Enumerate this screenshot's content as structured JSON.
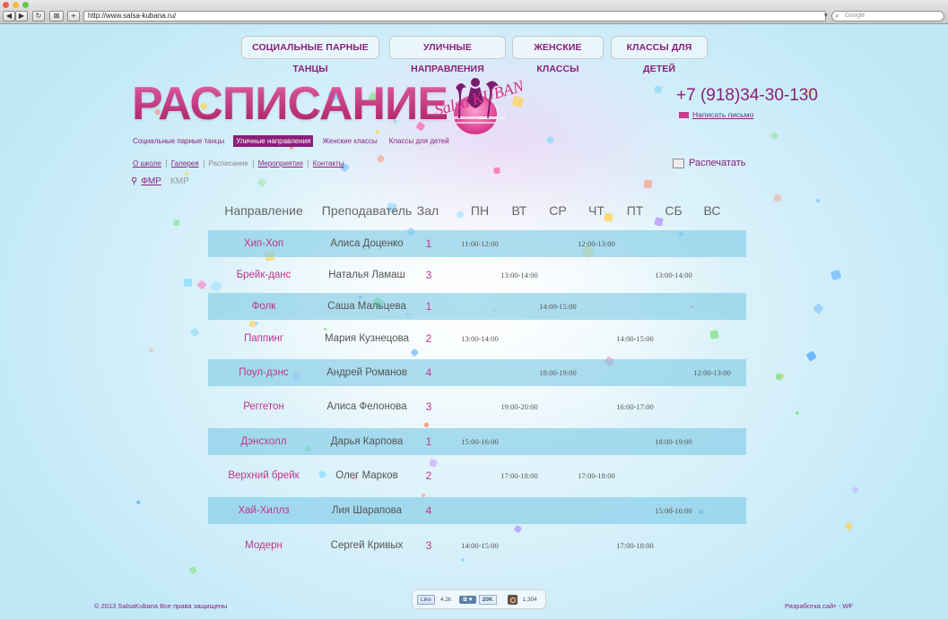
{
  "browser": {
    "url": "http://www.salsa-kubana.ru/",
    "search_placeholder": "Google",
    "back": "◀",
    "forward": "▶",
    "reload": "↻",
    "tabs": "⊠",
    "add": "+"
  },
  "top_nav": [
    "СОЦИАЛЬНЫЕ ПАРНЫЕ ТАНЦЫ",
    "УЛИЧНЫЕ НАПРАВЛЕНИЯ",
    "ЖЕНСКИЕ КЛАССЫ",
    "КЛАССЫ ДЛЯ ДЕТЕЙ"
  ],
  "page_title": "РАСПИСАНИЕ",
  "logo": {
    "text_main": "Salsa KUBANA",
    "text_sub": "dance school"
  },
  "contact": {
    "phone": "+7 (918)34-30-130",
    "mail_label": "Написать письмо"
  },
  "sub_nav": [
    {
      "label": "Социальные парные танцы",
      "active": false
    },
    {
      "label": "Уличные направления",
      "active": true
    },
    {
      "label": "Женские классы",
      "active": false
    },
    {
      "label": "Классы для детей",
      "active": false
    }
  ],
  "menu": [
    {
      "label": "О школе",
      "current": false
    },
    {
      "label": "Галерея",
      "current": false
    },
    {
      "label": "Расписание",
      "current": true
    },
    {
      "label": "Мероприятия",
      "current": false
    },
    {
      "label": "Контакты",
      "current": false
    }
  ],
  "print_label": "Распечатать",
  "branches": {
    "active": "ФМР",
    "other": "КМР"
  },
  "schedule": {
    "headers": {
      "direction": "Направление",
      "teacher": "Преподаватель",
      "hall": "Зал",
      "days": [
        "ПН",
        "ВТ",
        "СР",
        "ЧТ",
        "ПТ",
        "СБ",
        "ВС"
      ]
    },
    "rows": [
      {
        "direction": "Хип-Хоп",
        "teacher": "Алиса Доценко",
        "hall": "1",
        "times": [
          {
            "day": 0,
            "text": "11:00-12:00"
          },
          {
            "day": 3,
            "text": "12:00-13:00"
          }
        ]
      },
      {
        "direction": "Брейк-данс",
        "teacher": "Наталья Ламаш",
        "hall": "3",
        "times": [
          {
            "day": 1,
            "text": "13:00-14:00"
          },
          {
            "day": 5,
            "text": "13:00-14:00"
          }
        ]
      },
      {
        "direction": "Фолк",
        "teacher": "Саша Мальцева",
        "hall": "1",
        "times": [
          {
            "day": 2,
            "text": "14:00-15:00"
          }
        ]
      },
      {
        "direction": "Паппинг",
        "teacher": "Мария Кузнецова",
        "hall": "2",
        "times": [
          {
            "day": 0,
            "text": "13:00-14:00"
          },
          {
            "day": 4,
            "text": "14:00-15:00"
          }
        ]
      },
      {
        "direction": "Поул-дэнс",
        "teacher": "Андрей Романов",
        "hall": "4",
        "times": [
          {
            "day": 2,
            "text": "18:00-19:00"
          },
          {
            "day": 6,
            "text": "12:00-13:00"
          }
        ]
      },
      {
        "direction": "Реггетон",
        "teacher": "Алиса Фелонова",
        "hall": "3",
        "times": [
          {
            "day": 1,
            "text": "19:00-20:00"
          },
          {
            "day": 4,
            "text": "16:00-17:00"
          }
        ]
      },
      {
        "direction": "Дэнсхолл",
        "teacher": "Дарья Карпова",
        "hall": "1",
        "times": [
          {
            "day": 0,
            "text": "15:00-16:00"
          },
          {
            "day": 5,
            "text": "18:00-19:00"
          }
        ]
      },
      {
        "direction": "Верхний брейк",
        "teacher": "Олег Марков",
        "hall": "2",
        "times": [
          {
            "day": 1,
            "text": "17:00-18:00"
          },
          {
            "day": 3,
            "text": "17:00-18:00"
          }
        ]
      },
      {
        "direction": "Хай-Хиллз",
        "teacher": "Лия Шарапова",
        "hall": "4",
        "times": [
          {
            "day": 5,
            "text": "15:00-16:00"
          }
        ]
      },
      {
        "direction": "Модерн",
        "teacher": "Сергей Кривых",
        "hall": "3",
        "times": [
          {
            "day": 0,
            "text": "14:00-15:00"
          },
          {
            "day": 4,
            "text": "17:00-18:00"
          }
        ]
      }
    ]
  },
  "footer": {
    "copyright": "© 2013 SalsaKubana  Все права защищены",
    "developer": "Разработка сайт - WF",
    "social": {
      "fb_label": "Like",
      "fb_count": "4.2k",
      "vk_label": "В ♥",
      "vk_count": "20K",
      "ig_count": "1,304"
    }
  },
  "colors": {
    "brand": "#8a1f7a",
    "accent": "#c0348c",
    "row_shade": "#82cde6",
    "background": "#bfe8f7"
  },
  "icons": [
    "back-arrow-icon",
    "forward-arrow-icon",
    "reload-icon",
    "search-icon",
    "envelope-icon",
    "printer-icon",
    "location-pin-icon",
    "instagram-icon"
  ]
}
